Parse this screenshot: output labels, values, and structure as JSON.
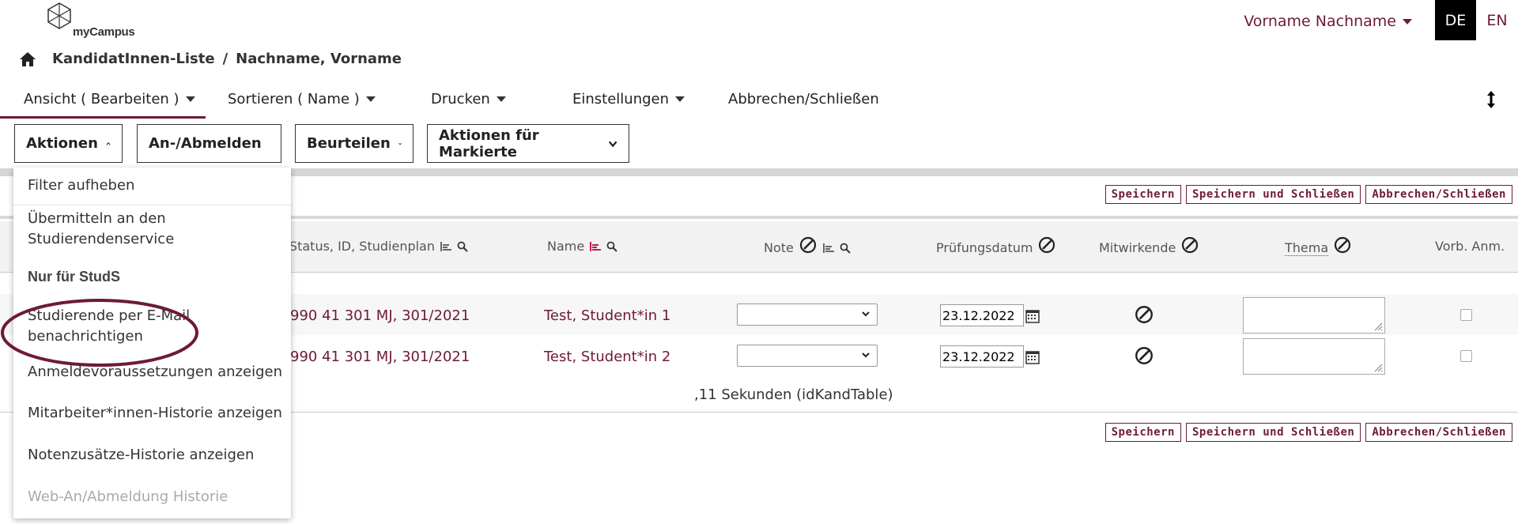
{
  "header": {
    "logo_text": "myCampus",
    "user_name": "Vorname Nachname",
    "lang_de": "DE",
    "lang_en": "EN"
  },
  "breadcrumb": {
    "parent": "KandidatInnen-Liste",
    "separator": "/",
    "current": "Nachname, Vorname"
  },
  "nav": {
    "view": "Ansicht ( Bearbeiten )",
    "sort": "Sortieren ( Name )",
    "print": "Drucken",
    "settings": "Einstellungen",
    "cancel_close": "Abbrechen/Schließen"
  },
  "actions": {
    "aktionen": "Aktionen",
    "an_abmelden": "An-/Abmelden",
    "beurteilen": "Beurteilen",
    "markierte": "Aktionen für Markierte"
  },
  "save_buttons": {
    "save": "Speichern",
    "save_close": "Speichern und Schließen",
    "cancel_close": "Abbrechen/Schließen"
  },
  "table": {
    "headers": {
      "status": "d-Status, ID, Studienplan",
      "name": "Name",
      "note": "Note",
      "date": "Prüfungsdatum",
      "mitwirkende": "Mitwirkende",
      "thema": "Thema",
      "vorb": "Vorb. Anm."
    },
    "rows": [
      {
        "status": "990 41 301 MJ, 301/2021",
        "name": "Test, Student*in 1",
        "date": "23.12.2022"
      },
      {
        "status": "990 41 301 MJ, 301/2021",
        "name": "Test, Student*in 2",
        "date": "23.12.2022"
      }
    ],
    "timing": ",11 Sekunden (idKandTable)"
  },
  "dropdown": {
    "items": [
      "Filter aufheben",
      "Übermitteln an den",
      "Studierendenservice",
      "Nur für StudS",
      "Studierende per E-Mail",
      "benachrichtigen",
      "Anmeldevoraussetzungen anzeigen",
      "Mitarbeiter*innen-Historie anzeigen",
      "Notenzusätze-Historie anzeigen",
      "Web-An/Abmeldung Historie"
    ]
  },
  "colors": {
    "brand": "#6e1b33",
    "highlight_ring": "#6e1b33"
  }
}
